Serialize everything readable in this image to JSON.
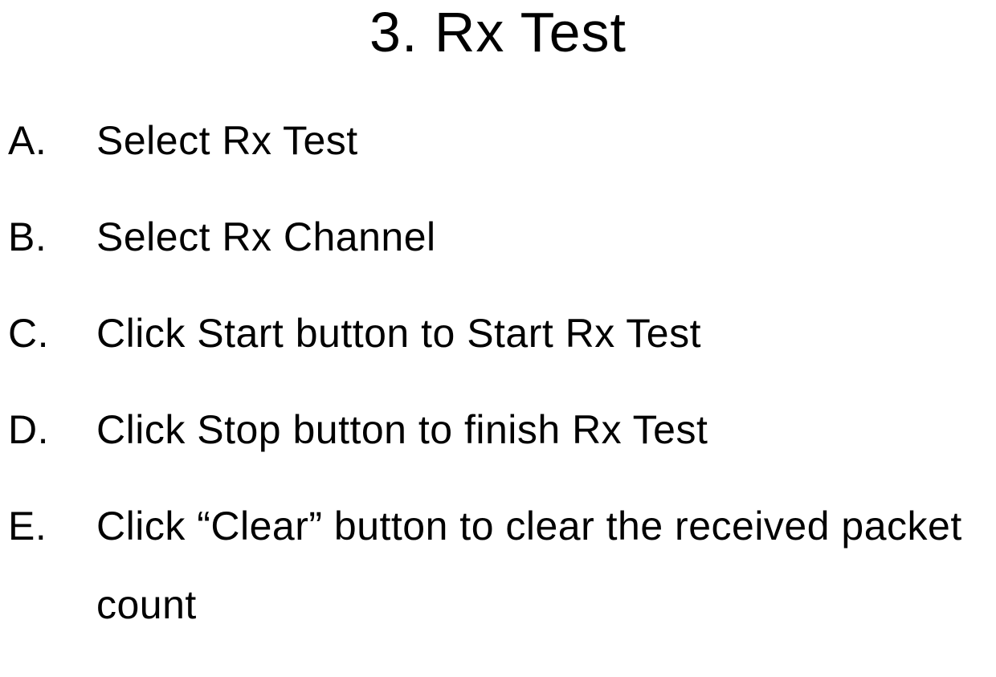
{
  "title": "3. Rx Test",
  "items": [
    {
      "marker": "A.",
      "text": "Select Rx Test"
    },
    {
      "marker": "B.",
      "text": "Select Rx Channel"
    },
    {
      "marker": "C.",
      "text": "Click Start button to Start Rx Test"
    },
    {
      "marker": "D.",
      "text": "Click Stop button to finish Rx Test"
    },
    {
      "marker": "E.",
      "text": "Click “Clear” button to clear the received packet count"
    }
  ]
}
